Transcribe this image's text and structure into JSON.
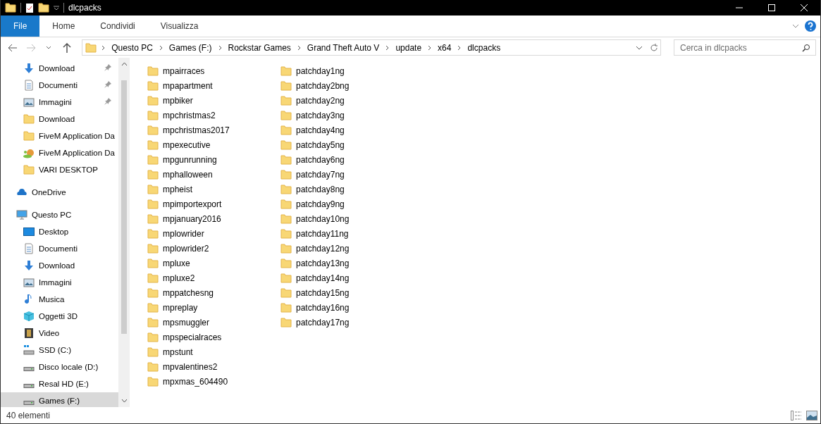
{
  "window": {
    "title": "dlcpacks"
  },
  "tabs": [
    {
      "label": "File",
      "selected": true
    },
    {
      "label": "Home",
      "selected": false
    },
    {
      "label": "Condividi",
      "selected": false
    },
    {
      "label": "Visualizza",
      "selected": false
    }
  ],
  "address": {
    "segments": [
      "Questo PC",
      "Games (F:)",
      "Rockstar Games",
      "Grand Theft Auto V",
      "update",
      "x64",
      "dlcpacks"
    ]
  },
  "search": {
    "placeholder": "Cerca in dlcpacks"
  },
  "sidebar": {
    "quick_access": [
      {
        "label": "Download",
        "kind": "download",
        "pinned": true
      },
      {
        "label": "Documenti",
        "kind": "documents",
        "pinned": true
      },
      {
        "label": "Immagini",
        "kind": "pictures",
        "pinned": true
      },
      {
        "label": "Download",
        "kind": "folder",
        "pinned": false
      },
      {
        "label": "FiveM Application Da",
        "kind": "folder",
        "pinned": false
      },
      {
        "label": "FiveM Application Da",
        "kind": "snail",
        "pinned": false
      },
      {
        "label": "VARI DESKTOP",
        "kind": "folder",
        "pinned": false
      }
    ],
    "nodes": [
      {
        "label": "OneDrive",
        "kind": "cloud",
        "selected": false
      },
      {
        "label": "Questo PC",
        "kind": "pc",
        "selected": false,
        "children": [
          {
            "label": "Desktop",
            "kind": "desktop",
            "selected": false
          },
          {
            "label": "Documenti",
            "kind": "documents",
            "selected": false
          },
          {
            "label": "Download",
            "kind": "download",
            "selected": false
          },
          {
            "label": "Immagini",
            "kind": "pictures",
            "selected": false
          },
          {
            "label": "Musica",
            "kind": "music",
            "selected": false
          },
          {
            "label": "Oggetti 3D",
            "kind": "cube",
            "selected": false
          },
          {
            "label": "Video",
            "kind": "video",
            "selected": false
          },
          {
            "label": "SSD  (C:)",
            "kind": "ssd",
            "selected": false
          },
          {
            "label": "Disco locale (D:)",
            "kind": "drive",
            "selected": false
          },
          {
            "label": "Resal HD (E:)",
            "kind": "drive",
            "selected": false
          },
          {
            "label": "Games (F:)",
            "kind": "drive",
            "selected": true
          }
        ]
      }
    ]
  },
  "files": [
    "mpairraces",
    "mpapartment",
    "mpbiker",
    "mpchristmas2",
    "mpchristmas2017",
    "mpexecutive",
    "mpgunrunning",
    "mphalloween",
    "mpheist",
    "mpimportexport",
    "mpjanuary2016",
    "mplowrider",
    "mplowrider2",
    "mpluxe",
    "mpluxe2",
    "mppatchesng",
    "mpreplay",
    "mpsmuggler",
    "mpspecialraces",
    "mpstunt",
    "mpvalentines2",
    "mpxmas_604490",
    "patchday1ng",
    "patchday2bng",
    "patchday2ng",
    "patchday3ng",
    "patchday4ng",
    "patchday5ng",
    "patchday6ng",
    "patchday7ng",
    "patchday8ng",
    "patchday9ng",
    "patchday10ng",
    "patchday11ng",
    "patchday12ng",
    "patchday13ng",
    "patchday14ng",
    "patchday15ng",
    "patchday16ng",
    "patchday17ng"
  ],
  "status_bar": {
    "count": "40 elementi"
  }
}
